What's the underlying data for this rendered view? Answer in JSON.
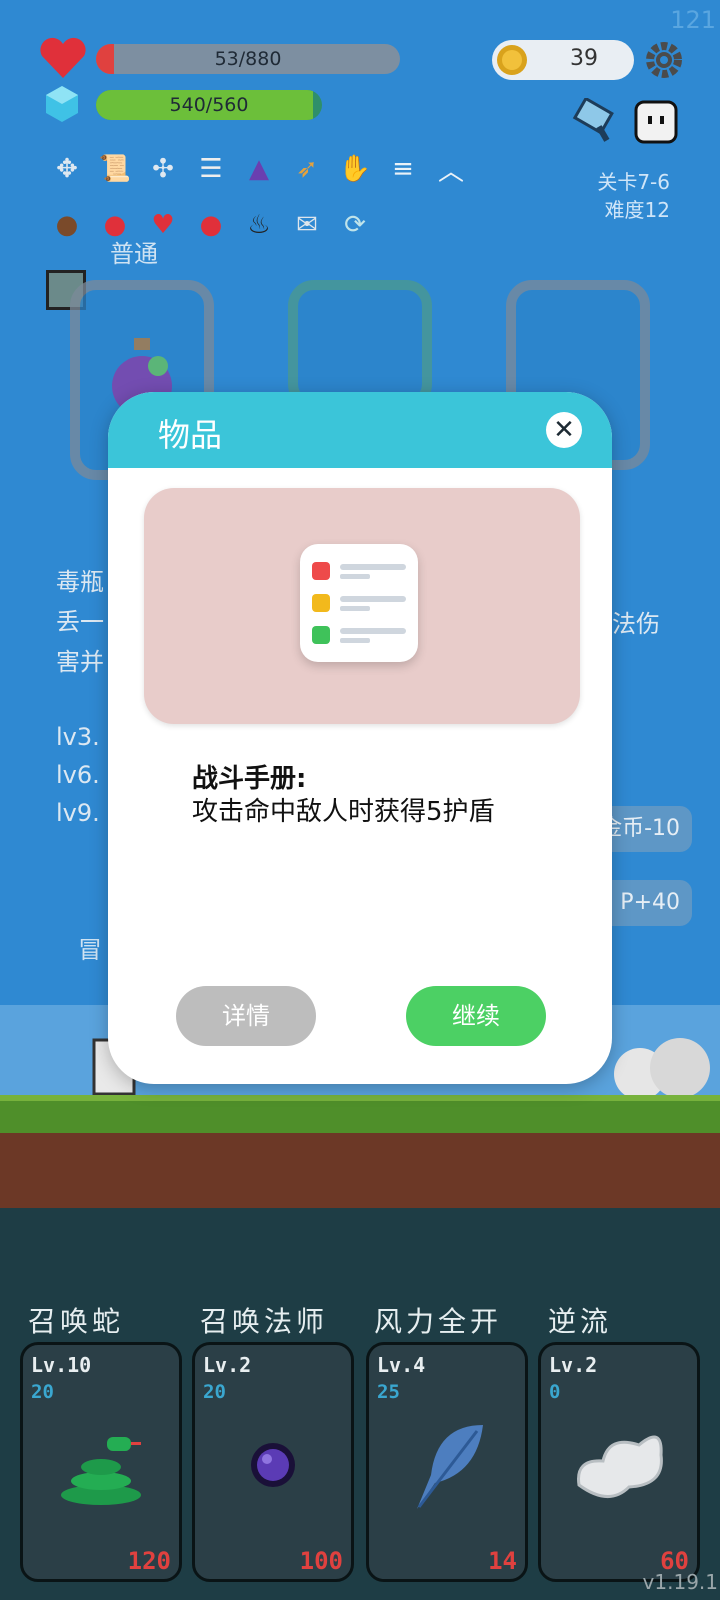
{
  "hud": {
    "fps": "121",
    "hp": "53/880",
    "hp_fraction": 0.06,
    "mp": "540/560",
    "mp_fraction": 0.96,
    "coins": "39",
    "stage": "关卡7-6",
    "difficulty": "难度12",
    "icon_row1": [
      "network-icon",
      "scroll-icon",
      "arrows-icon",
      "checklist-icon",
      "wizard-hat-icon",
      "bow-icon",
      "hand-icon",
      "slider-icon",
      "chevron-up-icon"
    ],
    "icon_row2": [
      "coconut-icon",
      "apple-icon",
      "heart-icon",
      "strawberry-icon",
      "cauldron-icon",
      "mail-icon",
      "cycle-icon"
    ]
  },
  "background": {
    "rarity_label": "普通",
    "desc_lines": [
      "毒瓶",
      "丢一",
      "害并"
    ],
    "desc_right": "法伤",
    "levels": [
      "lv3.",
      "lv6.",
      "lv9."
    ],
    "btn_coin": "金币-10",
    "btn_p": "P+40",
    "hero_label": "冒"
  },
  "modal": {
    "title": "物品",
    "close_icon": "close-icon",
    "item_icon": "checklist-icon",
    "item_name": "战斗手册:",
    "item_desc": "攻击命中敌人时获得5护盾",
    "detail_label": "详情",
    "continue_label": "继续",
    "colors": {
      "header": "#3bc5d9",
      "continue": "#4cd064",
      "detail": "#bdbdbd"
    }
  },
  "skills": [
    {
      "title": "召唤蛇",
      "level": "Lv.10",
      "cost": "20",
      "value": "120",
      "icon": "snake-icon"
    },
    {
      "title": "召唤法师",
      "level": "Lv.2",
      "cost": "20",
      "value": "100",
      "icon": "orb-icon"
    },
    {
      "title": "风力全开",
      "level": "Lv.4",
      "cost": "25",
      "value": "14",
      "icon": "feather-icon"
    },
    {
      "title": "逆流",
      "level": "Lv.2",
      "cost": "0",
      "value": "60",
      "icon": "cloud-icon"
    }
  ],
  "version": "v1.19.1"
}
